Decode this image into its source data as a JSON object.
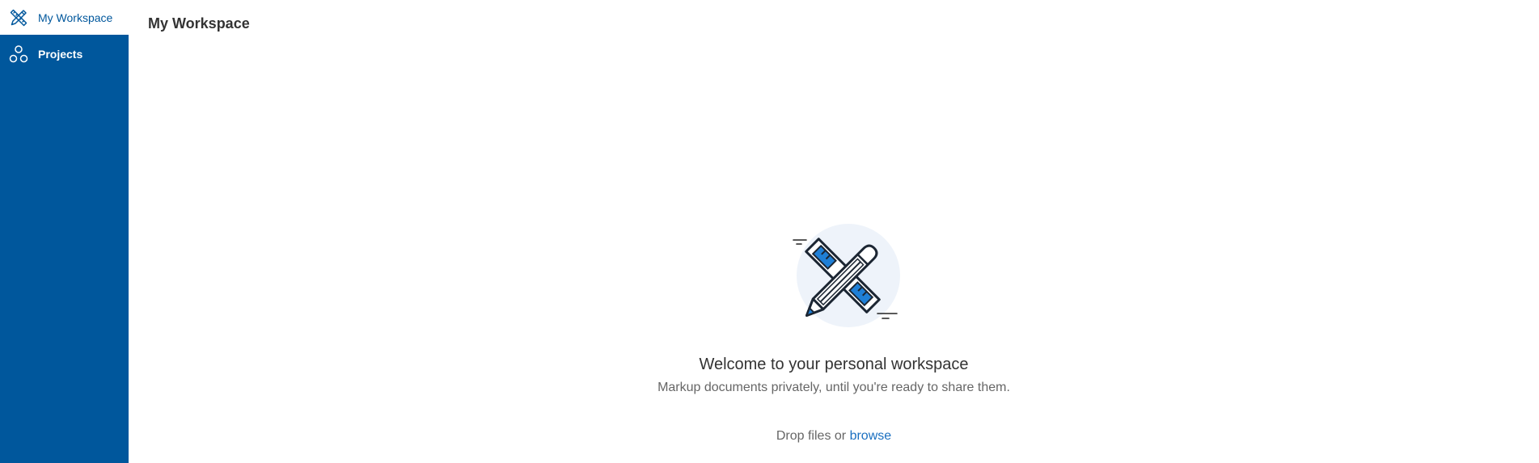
{
  "sidebar": {
    "items": [
      {
        "label": "My Workspace",
        "icon": "pencil-ruler-icon",
        "active": true
      },
      {
        "label": "Projects",
        "icon": "projects-circles-icon",
        "active": false
      }
    ]
  },
  "header": {
    "title": "My Workspace"
  },
  "empty_state": {
    "illustration": "pencil-ruler-illustration",
    "title": "Welcome to your personal workspace",
    "subtitle": "Markup documents privately, until you're ready to share them.",
    "drop_text": "Drop files or ",
    "browse_label": "browse"
  },
  "colors": {
    "sidebar_bg": "#00579c",
    "accent": "#1a6fc0",
    "illustration_blue": "#1f7fd6",
    "illustration_bg": "#eef3fa"
  }
}
